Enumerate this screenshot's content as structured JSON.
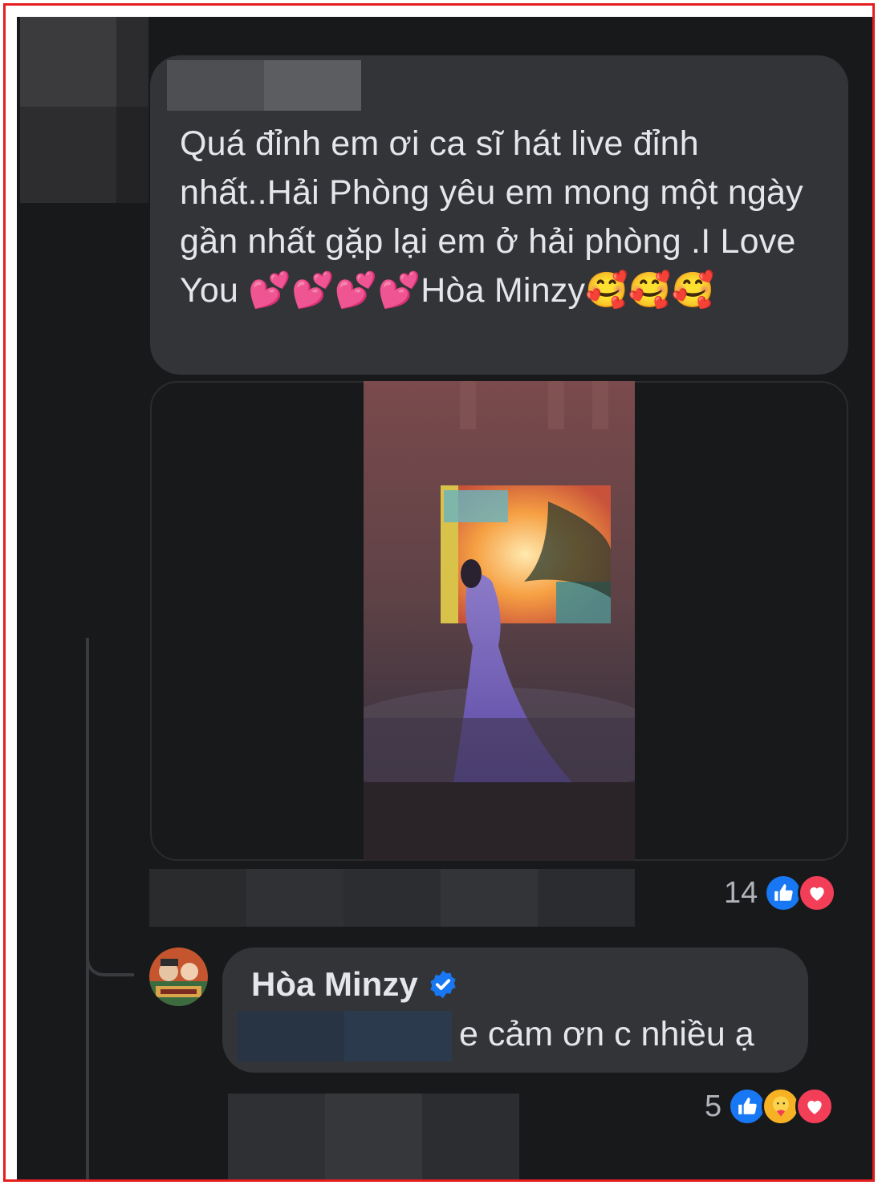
{
  "comment": {
    "text": "Quá đỉnh em ơi ca sĩ hát live đỉnh nhất..Hải Phòng yêu em mong một ngày gần nhất gặp lại em ở hải phòng .I Love You 💕💕💕💕Hòa Minzy🥰🥰🥰",
    "reaction_count": "14",
    "reaction_icons": [
      "like-icon",
      "love-icon"
    ]
  },
  "reply": {
    "author": "Hòa Minzy",
    "verified": true,
    "text": "e cảm ơn c nhiều ạ",
    "reaction_count": "5",
    "reaction_icons": [
      "like-icon",
      "care-icon",
      "love-icon"
    ]
  },
  "colors": {
    "background": "#18191b",
    "bubble": "#333437",
    "text": "#e4e6eb",
    "like": "#1877f2",
    "love": "#f33e58",
    "frame": "#e41e1e"
  }
}
